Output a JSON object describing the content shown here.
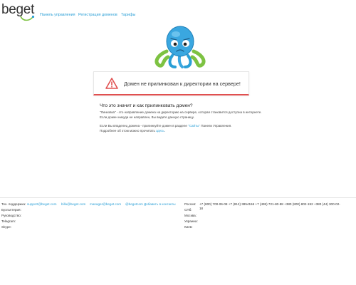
{
  "header": {
    "logo": "beget",
    "nav": [
      "Панель управления",
      "Регистрация доменов",
      "Тарифы"
    ]
  },
  "error_card": {
    "title": "Домен не прилинкован к директории на сервере!"
  },
  "info": {
    "title": "Что это значит и как прилинковать домен?",
    "p1": "\"Линковка\" - это направление домена на директорию на сервере, которая становится доступна в интернете. Если домен никуда не направлен, Вы видите данную страницу.",
    "p2_pre": "Если Вы владелец домена - прилинкуйте домен в разделе ",
    "p2_link": "\"Сайты\"",
    "p2_post": " Панели Управления.",
    "p3_pre": "Подробнее об этом можно прочитать ",
    "p3_link": "здесь",
    "p3_post": "."
  },
  "footer": {
    "left_labels": [
      "Тех. поддержка:",
      "Бухгалтерия:",
      "Руководство:",
      "Telegram:",
      "Skype:"
    ],
    "emails": [
      "support@beget.com",
      "billu@beget.com",
      "manager@beget.com",
      "@begetcom"
    ],
    "add_contacts": "Добавить в контакты",
    "right_labels": [
      "Россия:",
      "СПб:",
      "Москва:",
      "Украина:",
      "Киев:"
    ],
    "phones_line1": "+7 (800) 700-06-08  +7 (812) 3854156  +7 (495) 721-80-88  +380 (800) 802-192  +380 (44) 300-02-",
    "phones_line2": "18"
  }
}
